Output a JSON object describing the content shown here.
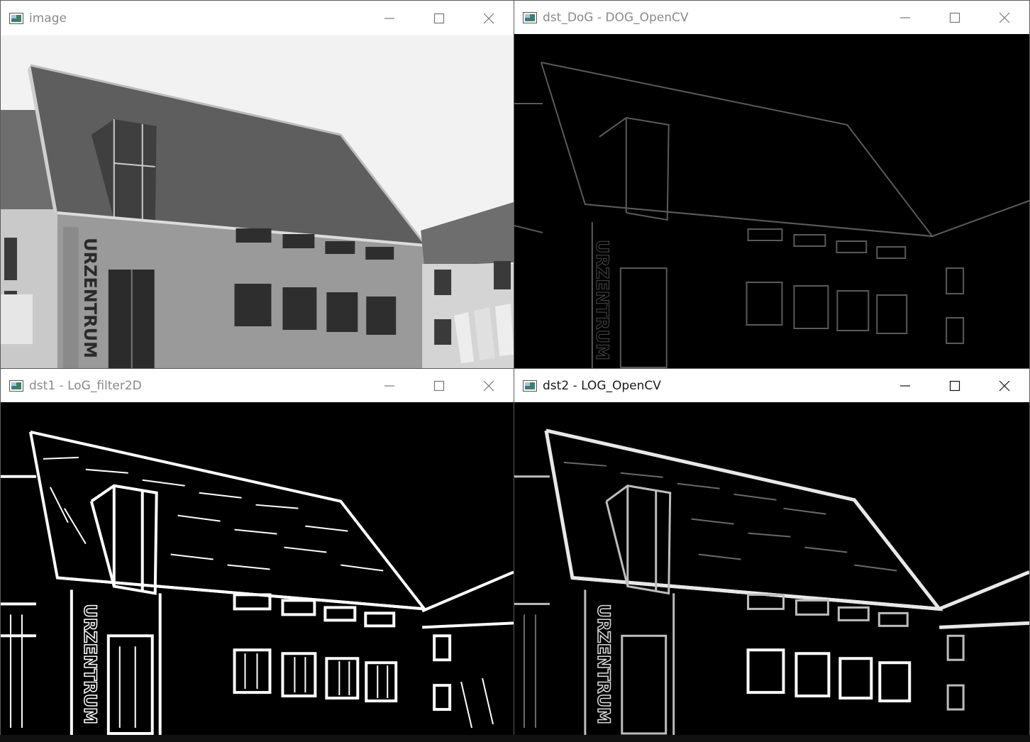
{
  "windows": [
    {
      "title": "image",
      "state": "inactive",
      "kind": "grayscale-photo",
      "icon": "opencv-image-window-icon"
    },
    {
      "title": "dst_DoG - DOG_OpenCV",
      "state": "inactive",
      "kind": "dog-edges",
      "icon": "opencv-image-window-icon"
    },
    {
      "title": "dst1 - LoG_filter2D",
      "state": "inactive",
      "kind": "log-filter2d-edges",
      "icon": "opencv-image-window-icon"
    },
    {
      "title": "dst2 - LOG_OpenCV",
      "state": "active",
      "kind": "log-opencv-edges",
      "icon": "opencv-image-window-icon"
    }
  ],
  "colors": {
    "titlebar": "#ffffff",
    "inactive_title_text": "#8a8a8a",
    "active_title_text": "#1a1a1a",
    "edge_background": "#000000",
    "sky": "#f2f2f2"
  },
  "icons": [
    "minimize-icon",
    "maximize-icon",
    "close-icon"
  ]
}
